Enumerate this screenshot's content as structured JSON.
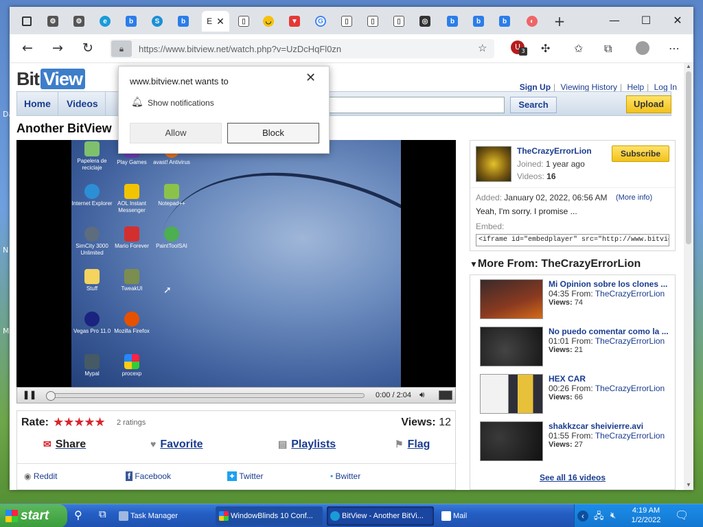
{
  "browser": {
    "url": "https://www.bitview.net/watch.php?v=UzDcHqFl0zn",
    "active_tab_letter": "E",
    "extension_badge": "3"
  },
  "site": {
    "logo_a": "Bit",
    "logo_b": "View",
    "top_links": [
      "Sign Up",
      "Viewing History",
      "Help",
      "Log In"
    ],
    "nav": [
      "Home",
      "Videos"
    ],
    "search_label": "Search",
    "upload_label": "Upload"
  },
  "video": {
    "title": "Another BitView",
    "time": "0:00 / 2:04",
    "rate_label": "Rate:",
    "rating_count": "2 ratings",
    "views_label": "Views:",
    "views": "12",
    "actions": [
      "Share",
      "Favorite",
      "Playlists",
      "Flag"
    ],
    "social": [
      "Reddit",
      "Facebook",
      "Twitter",
      "Bwitter"
    ]
  },
  "desktop_icons": [
    "Papelera de reciclaje",
    "Play Games",
    "avast! Antivirus",
    "Internet Explorer",
    "AOL Instant Messenger",
    "Notepad++",
    "SimCity 3000 Unlimited",
    "Mario Forever",
    "PaintToolSAI",
    "Stuff",
    "TweakUI",
    "Vegas Pro 11.0",
    "Mozilla Firefox",
    "Mypal",
    "procexp"
  ],
  "uploader": {
    "name": "TheCrazyErrorLion",
    "joined_label": "Joined:",
    "joined": "1 year ago",
    "videos_label": "Videos:",
    "videos": "16",
    "subscribe": "Subscribe",
    "added_label": "Added:",
    "added": "January 02, 2022, 06:56 AM",
    "more_info": "(More info)",
    "description": "Yeah, I'm sorry. I promise ...",
    "embed_label": "Embed:",
    "embed_code": "<iframe id=\"embedplayer\" src=\"http://www.bitview.net/embed.p"
  },
  "more_from": {
    "title": "More From: TheCrazyErrorLion",
    "from_label": "From:",
    "views_label": "Views:",
    "items": [
      {
        "title": "Mi Opinion sobre los clones ...",
        "duration": "04:35",
        "author": "TheCrazyErrorLion",
        "views": "74"
      },
      {
        "title": "No puedo comentar como la ...",
        "duration": "01:01",
        "author": "TheCrazyErrorLion",
        "views": "21"
      },
      {
        "title": "HEX CAR",
        "duration": "00:26",
        "author": "TheCrazyErrorLion",
        "views": "66"
      },
      {
        "title": "shakkzcar sheivierre.avi",
        "duration": "01:55",
        "author": "TheCrazyErrorLion",
        "views": "27"
      }
    ],
    "see_all": "See all 16 videos"
  },
  "popup": {
    "title": "www.bitview.net wants to",
    "permission": "Show notifications",
    "allow": "Allow",
    "block": "Block"
  },
  "taskbar": {
    "start": "start",
    "items": [
      "Task Manager",
      "WindowBlinds 10 Conf...",
      "BitView - Another BitVi...",
      "Mail"
    ],
    "time": "4:19 AM",
    "date": "1/2/2022"
  },
  "colors": {
    "link": "#1a3c8f",
    "star": "#d8262d",
    "accent": "#f3c21a"
  }
}
